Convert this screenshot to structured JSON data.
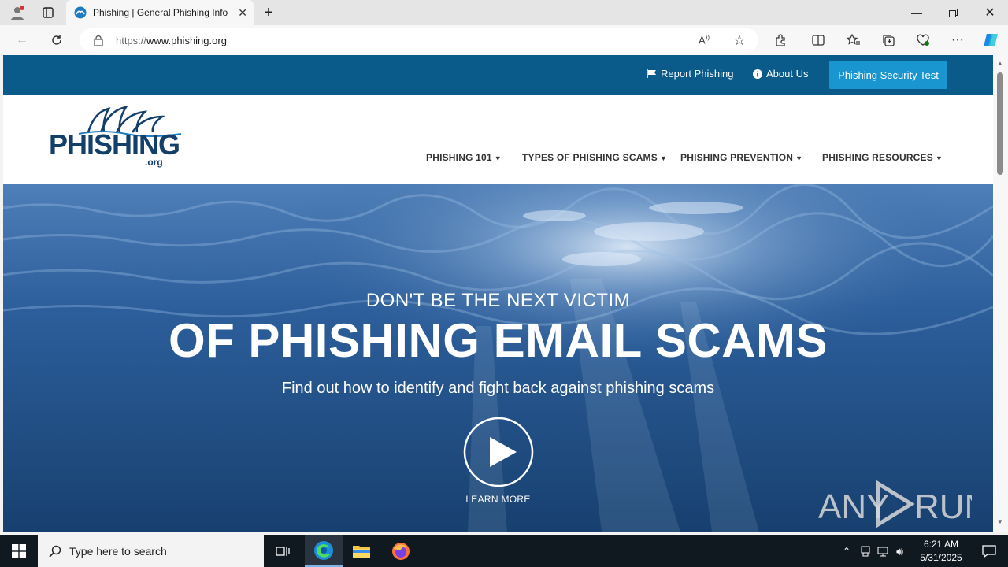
{
  "browser": {
    "tab_title": "Phishing | General Phishing Information",
    "url_prefix": "https://",
    "url_host": "www.phishing.org"
  },
  "site": {
    "top_links": {
      "report": "Report Phishing",
      "about": "About Us",
      "test_button": "Phishing Security Test"
    },
    "logo_text": "PHISHING",
    "logo_suffix": ".org",
    "menu": [
      {
        "label": "PHISHING 101"
      },
      {
        "label": "TYPES OF PHISHING SCAMS"
      },
      {
        "label": "PHISHING PREVENTION"
      },
      {
        "label": "PHISHING RESOURCES"
      }
    ],
    "hero": {
      "subheading": "DON'T BE THE NEXT VICTIM",
      "heading": "OF PHISHING EMAIL SCAMS",
      "tagline": "Find out how to identify and fight back against phishing scams",
      "cta": "LEARN MORE"
    },
    "watermark": "ANY RUN"
  },
  "taskbar": {
    "search_placeholder": "Type here to search",
    "time": "6:21 AM",
    "date": "5/31/2025"
  },
  "colors": {
    "top_strip": "#0b5b8a",
    "test_button": "#1995cf",
    "logo_blue": "#143f6b"
  }
}
